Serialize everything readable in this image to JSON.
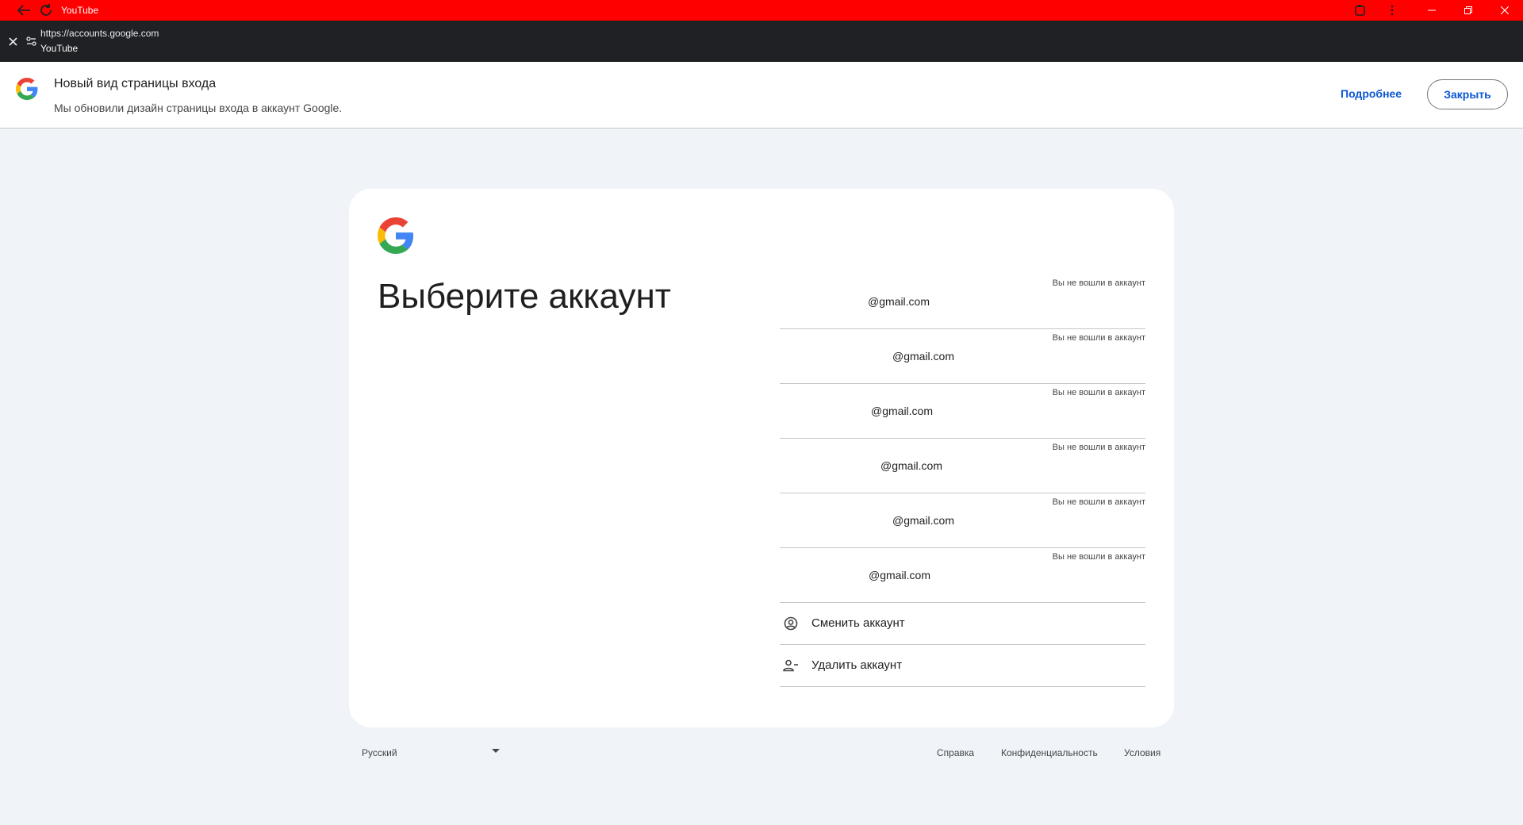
{
  "window": {
    "title": "YouTube",
    "accent_color": "#ff0000"
  },
  "addressbar": {
    "url": "https://accounts.google.com",
    "site_name": "YouTube"
  },
  "banner": {
    "title": "Новый вид страницы входа",
    "text": "Мы обновили дизайн страницы входа в аккаунт Google.",
    "more_label": "Подробнее",
    "close_label": "Закрыть"
  },
  "card": {
    "heading": "Выберите аккаунт",
    "accounts": [
      {
        "email": "@gmail.com",
        "status": "Вы не вошли в аккаунт"
      },
      {
        "email": "@gmail.com",
        "status": "Вы не вошли в аккаунт"
      },
      {
        "email": "@gmail.com",
        "status": "Вы не вошли в аккаунт"
      },
      {
        "email": "@gmail.com",
        "status": "Вы не вошли в аккаунт"
      },
      {
        "email": "@gmail.com",
        "status": "Вы не вошли в аккаунт"
      },
      {
        "email": "@gmail.com",
        "status": "Вы не вошли в аккаунт"
      }
    ],
    "switch_account_label": "Сменить аккаунт",
    "remove_account_label": "Удалить аккаунт"
  },
  "footer": {
    "language": "Русский",
    "help": "Справка",
    "privacy": "Конфиденциальность",
    "terms": "Условия"
  }
}
